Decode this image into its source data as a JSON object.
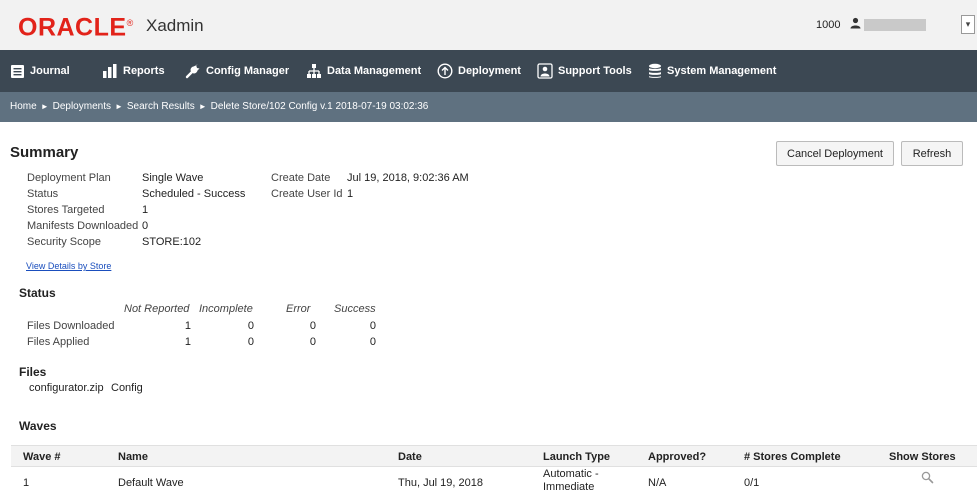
{
  "header": {
    "logo_text": "ORACLE",
    "logo_mark": "®",
    "app_name": "Xadmin",
    "store_number": "1000",
    "dropdown_glyph": "▾",
    "colors": {
      "brand": "#e2231a",
      "nav_bg": "#3c4853",
      "breadcrumb_bg": "#5f7180",
      "link": "#1a4ebd"
    }
  },
  "nav": {
    "items": [
      {
        "label": "Journal",
        "icon": "journal-icon"
      },
      {
        "label": "Reports",
        "icon": "bar-chart-icon"
      },
      {
        "label": "Config Manager",
        "icon": "wrench-icon"
      },
      {
        "label": "Data Management",
        "icon": "hierarchy-icon"
      },
      {
        "label": "Deployment",
        "icon": "cloud-upload-icon"
      },
      {
        "label": "Support Tools",
        "icon": "support-person-icon"
      },
      {
        "label": "System Management",
        "icon": "database-icon"
      }
    ]
  },
  "breadcrumb": {
    "items": [
      "Home",
      "Deployments",
      "Search Results",
      "Delete Store/102 Config v.1 2018-07-19 03:02:36"
    ],
    "separator": "►"
  },
  "summary": {
    "title": "Summary",
    "cancel_label": "Cancel Deployment",
    "refresh_label": "Refresh",
    "fields": [
      {
        "label": "Deployment Plan",
        "value": "Single Wave"
      },
      {
        "label": "Status",
        "value": "Scheduled - Success"
      },
      {
        "label": "Stores Targeted",
        "value": "1"
      },
      {
        "label": "Manifests Downloaded",
        "value": "0"
      },
      {
        "label": "Security Scope",
        "value": "STORE:102"
      }
    ],
    "fields_right": [
      {
        "label": "Create Date",
        "value": "Jul 19, 2018, 9:02:36 AM"
      },
      {
        "label": "Create User Id",
        "value": "1"
      }
    ],
    "details_link": "View Details by Store"
  },
  "status": {
    "title": "Status",
    "columns": [
      "Not Reported",
      "Incomplete",
      "Error",
      "Success"
    ],
    "rows": [
      {
        "label": "Files Downloaded",
        "values": [
          "1",
          "0",
          "0",
          "0"
        ]
      },
      {
        "label": "Files Applied",
        "values": [
          "1",
          "0",
          "0",
          "0"
        ]
      }
    ]
  },
  "files": {
    "title": "Files",
    "items": [
      {
        "name": "configurator.zip",
        "type": "Config"
      }
    ]
  },
  "waves": {
    "title": "Waves",
    "columns": [
      "Wave #",
      "Name",
      "Date",
      "Launch Type",
      "Approved?",
      "# Stores Complete",
      "Show Stores"
    ],
    "rows": [
      {
        "wave": "1",
        "name": "Default Wave",
        "date": "Thu, Jul 19, 2018",
        "launch_type": "Automatic - Immediate",
        "approved": "N/A",
        "stores_complete": "0/1",
        "show_stores_icon": "magnifier-icon"
      }
    ]
  }
}
